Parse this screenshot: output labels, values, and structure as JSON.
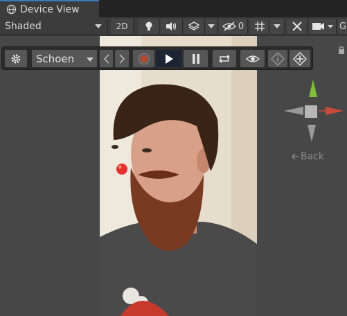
{
  "window": {
    "tab_label": "Device View"
  },
  "toolbar": {
    "shading_mode": "Shaded",
    "mode_2d_label": "2D",
    "hidden_count": "0",
    "camera_truncated_label": "G"
  },
  "overlay": {
    "scene_name": "Schoen"
  },
  "gizmo": {
    "back_label": "Back"
  },
  "colors": {
    "accent_tab": "#3a79bb",
    "record": "#c0392b",
    "play_active_bg": "#1d2433",
    "gizmo_x": "#c94a3a",
    "gizmo_y": "#7fbf3a"
  },
  "icons": {
    "tab": "globe-icon",
    "toolbar": [
      "lightbulb-icon",
      "speaker-icon",
      "layers-icon",
      "visibility-off-icon",
      "grid-icon",
      "tools-icon",
      "camera-icon"
    ],
    "overlay": [
      "gear-icon",
      "chevron-left-icon",
      "chevron-right-icon",
      "record-icon",
      "play-icon",
      "pause-icon",
      "loop-icon",
      "eye-icon",
      "info-icon",
      "move-icon"
    ]
  }
}
